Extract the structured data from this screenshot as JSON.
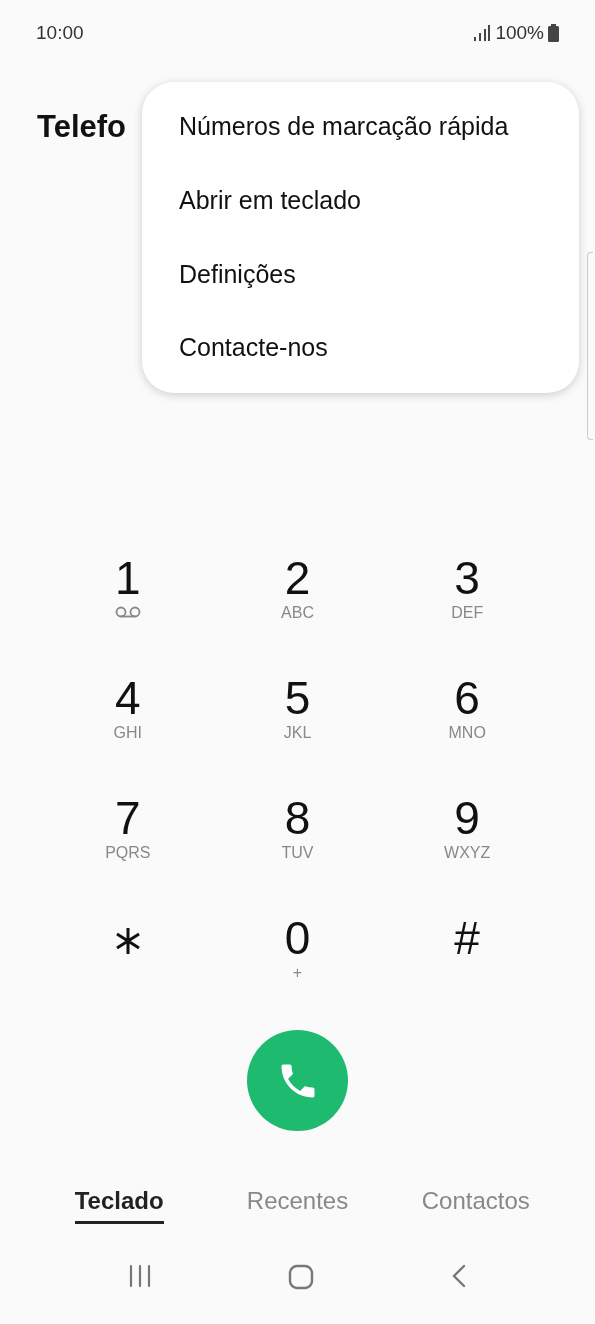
{
  "status_bar": {
    "time": "10:00",
    "battery": "100%"
  },
  "title": "Telefo",
  "menu": [
    "Números de marcação rápida",
    "Abrir em teclado",
    "Definições",
    "Contacte-nos"
  ],
  "keys": [
    {
      "kind": "digit",
      "digit": "1",
      "voicemail": true
    },
    {
      "kind": "digit",
      "digit": "2",
      "letters": "ABC"
    },
    {
      "kind": "digit",
      "digit": "3",
      "letters": "DEF"
    },
    {
      "kind": "digit",
      "digit": "4",
      "letters": "GHI"
    },
    {
      "kind": "digit",
      "digit": "5",
      "letters": "JKL"
    },
    {
      "kind": "digit",
      "digit": "6",
      "letters": "MNO"
    },
    {
      "kind": "digit",
      "digit": "7",
      "letters": "PQRS"
    },
    {
      "kind": "digit",
      "digit": "8",
      "letters": "TUV"
    },
    {
      "kind": "digit",
      "digit": "9",
      "letters": "WXYZ"
    },
    {
      "kind": "asterisk"
    },
    {
      "kind": "digit",
      "digit": "0",
      "letters": "+"
    },
    {
      "kind": "digit",
      "digit": "#"
    }
  ],
  "tabs": [
    {
      "label": "Teclado",
      "selected": true
    },
    {
      "label": "Recentes",
      "selected": false
    },
    {
      "label": "Contactos",
      "selected": false
    }
  ]
}
